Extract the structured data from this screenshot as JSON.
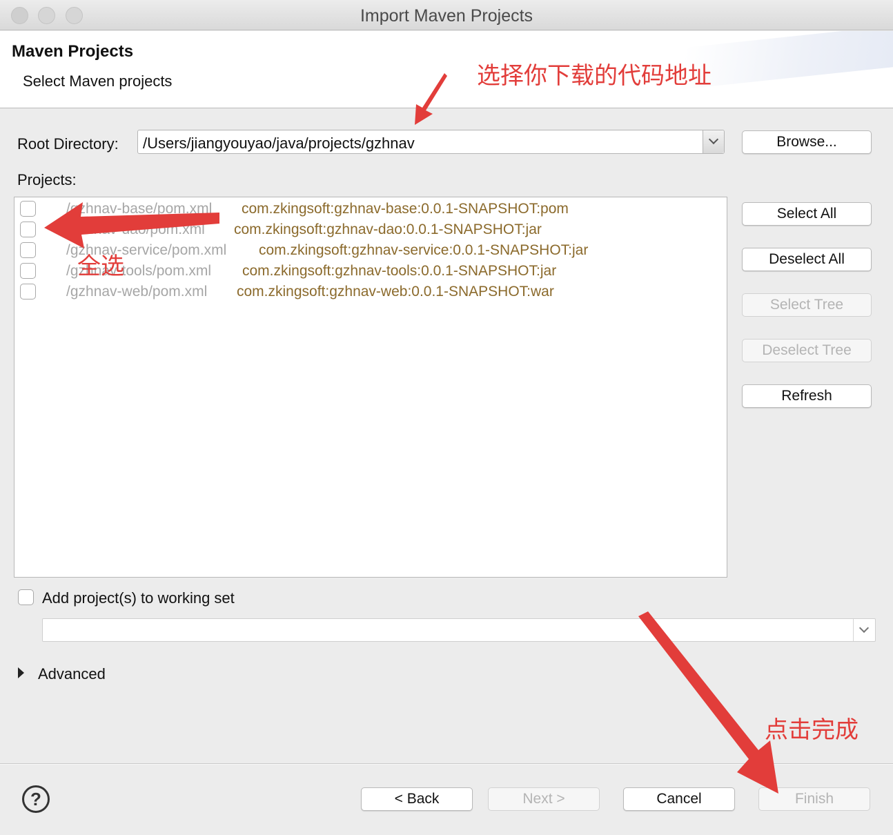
{
  "window": {
    "title": "Import Maven Projects"
  },
  "header": {
    "title": "Maven Projects",
    "subtitle": "Select Maven projects"
  },
  "root_directory": {
    "label": "Root Directory:",
    "value": "/Users/jiangyouyao/java/projects/gzhnav",
    "browse_label": "Browse..."
  },
  "projects": {
    "label": "Projects:",
    "items": [
      {
        "path": "/gzhnav-base/pom.xml",
        "id": "com.zkingsoft:gzhnav-base:0.0.1-SNAPSHOT:pom",
        "checked": false
      },
      {
        "path": "/gzhnav-dao/pom.xml",
        "id": "com.zkingsoft:gzhnav-dao:0.0.1-SNAPSHOT:jar",
        "checked": false
      },
      {
        "path": "/gzhnav-service/pom.xml",
        "id": "com.zkingsoft:gzhnav-service:0.0.1-SNAPSHOT:jar",
        "checked": false
      },
      {
        "path": "/gzhnav-tools/pom.xml",
        "id": "com.zkingsoft:gzhnav-tools:0.0.1-SNAPSHOT:jar",
        "checked": false
      },
      {
        "path": "/gzhnav-web/pom.xml",
        "id": "com.zkingsoft:gzhnav-web:0.0.1-SNAPSHOT:war",
        "checked": false
      }
    ]
  },
  "side_buttons": {
    "select_all": "Select All",
    "deselect_all": "Deselect All",
    "select_tree": "Select Tree",
    "deselect_tree": "Deselect Tree",
    "refresh": "Refresh"
  },
  "working_set": {
    "label": "Add project(s) to working set",
    "checked": false,
    "value": ""
  },
  "advanced": {
    "label": "Advanced"
  },
  "footer": {
    "help": "?",
    "back": "< Back",
    "next": "Next >",
    "cancel": "Cancel",
    "finish": "Finish"
  },
  "annotations": {
    "root_hint": "选择你下载的代码地址",
    "select_all_hint": "全选",
    "finish_hint": "点击完成",
    "color": "#e23d3a"
  }
}
